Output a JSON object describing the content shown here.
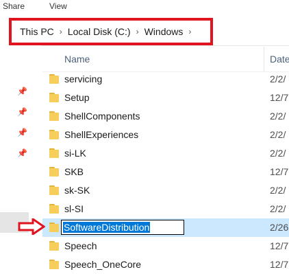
{
  "ribbon": {
    "share_label": "Share",
    "view_label": "View"
  },
  "breadcrumb": [
    "This PC",
    "Local Disk (C:)",
    "Windows"
  ],
  "breadcrumb_separator": "›",
  "columns": {
    "name": "Name",
    "date": "Date"
  },
  "rows": [
    {
      "name": "servicing",
      "date": "2/2/"
    },
    {
      "name": "Setup",
      "date": "12/7"
    },
    {
      "name": "ShellComponents",
      "date": "2/2/"
    },
    {
      "name": "ShellExperiences",
      "date": "2/2/"
    },
    {
      "name": "si-LK",
      "date": "2/2/"
    },
    {
      "name": "SKB",
      "date": "12/7"
    },
    {
      "name": "sk-SK",
      "date": "2/2/"
    },
    {
      "name": "sl-SI",
      "date": "2/2/"
    },
    {
      "name": "SoftwareDistribution",
      "date": "2/26",
      "selected": true,
      "renaming": true
    },
    {
      "name": "Speech",
      "date": "12/7"
    },
    {
      "name": "Speech_OneCore",
      "date": "12/7"
    }
  ],
  "colors": {
    "highlight_box": "#e0141e",
    "selection": "#cce8ff",
    "rename_selection": "#0078d7",
    "folder": "#f7cd5b",
    "arrow": "#e0141e"
  },
  "icons": {
    "pin": "pin-icon",
    "folder": "folder-icon",
    "arrow": "red-arrow-icon"
  }
}
